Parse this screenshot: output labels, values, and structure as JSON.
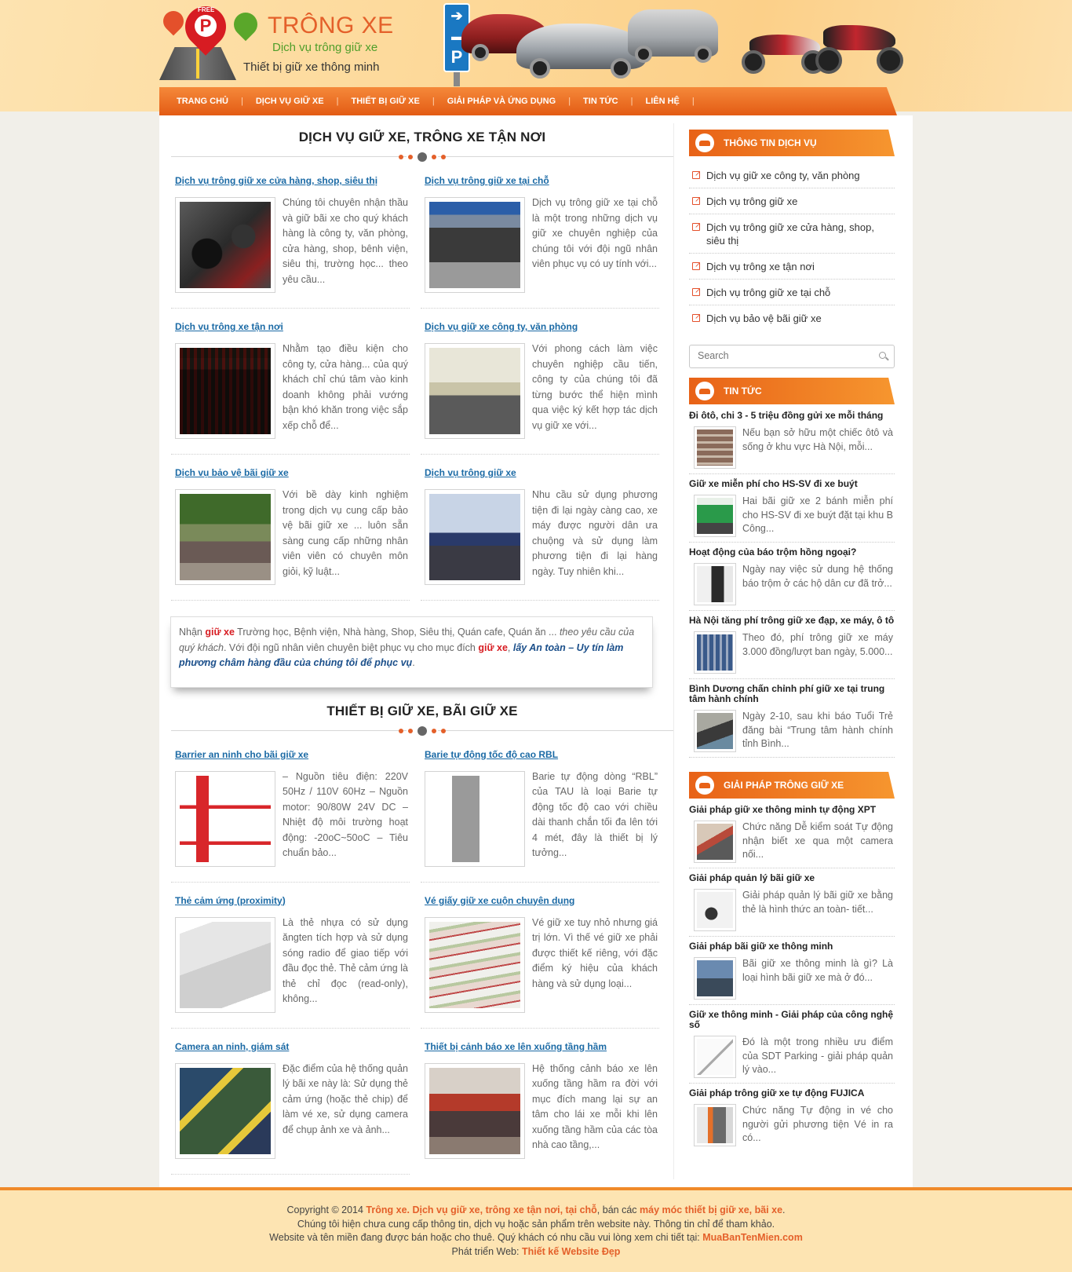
{
  "brand": {
    "title": "TRÔNG XE",
    "subtitle": "Dịch vụ trông giữ xe",
    "tagline": "Thiết bị giữ xe thông minh",
    "free_tag": "FREE",
    "p_letter": "P"
  },
  "nav": {
    "items": [
      {
        "label": "TRANG CHỦ"
      },
      {
        "label": "DỊCH VỤ GIỮ XE"
      },
      {
        "label": "THIẾT BỊ GIỮ XE"
      },
      {
        "label": "GIẢI PHÁP VÀ ỨNG DỤNG"
      },
      {
        "label": "TIN TỨC"
      },
      {
        "label": "LIÊN HỆ"
      }
    ]
  },
  "services_section": {
    "title": "DỊCH VỤ GIỮ XE, TRÔNG XE TẬN NƠI",
    "cards": [
      {
        "title": "Dịch vụ trông giữ xe cửa hàng, shop, siêu thị",
        "text": "Chúng tôi chuyên nhận thầu và giữ bãi xe cho quý khách hàng là công ty, văn phòng, cửa hàng, shop, bênh viện, siêu thị, trường học... theo yêu cầu..."
      },
      {
        "title": "Dịch vụ trông giữ xe tại chỗ",
        "text": "Dịch vụ trông giữ xe tại chỗ là một trong những dịch vụ giữ xe chuyên nghiệp của chúng tôi với đội ngũ nhân viên phục vụ có uy tính với..."
      },
      {
        "title": "Dịch vụ trông xe tận nơi",
        "text": "Nhằm tạo điều kiện cho công ty, cửa hàng... của quý khách chỉ chú tâm vào kinh doanh không phải vướng bận khó khăn trong việc sắp xếp chỗ để..."
      },
      {
        "title": "Dịch vụ giữ xe công ty, văn phòng",
        "text": "Với phong cách làm việc chuyên nghiệp cầu tiến, công ty của chúng tôi đã từng bước thể hiện mình qua việc ký kết hợp tác dịch vụ giữ xe với..."
      },
      {
        "title": "Dịch vụ bảo vệ bãi giữ xe",
        "text": "Với bề dày kinh nghiệm trong dịch vụ cung cấp bảo vệ bãi giữ xe ... luôn sẵn sàng cung cấp những nhân viên viên có chuyên môn giỏi, kỹ luật..."
      },
      {
        "title": "Dịch vụ trông giữ xe",
        "text": "Nhu cầu sử dụng phương tiện đi lại ngày càng cao, xe máy được người dân ưa chuộng và sử dụng làm phương tiện đi lại hàng ngày. Tuy nhiên khi..."
      }
    ]
  },
  "quote": {
    "p1": "Nhận ",
    "hl1": "giữ xe",
    "p2": " Trường học, Bệnh viện, Nhà hàng, Shop, Siêu thị, Quán cafe, Quán ăn ... ",
    "it1": "theo yêu cầu của quý khách",
    "p3": ". Với đội ngũ nhân viên chuyên biệt phục vụ cho mục đích ",
    "hl2": "giữ xe",
    "p4": ", ",
    "bi1": "lấy An toàn – Uy tín làm phương châm hàng đầu của chúng tôi để phục vụ",
    "p5": "."
  },
  "equipment_section": {
    "title": "THIẾT BỊ GIỮ XE, BÃI GIỮ XE",
    "cards": [
      {
        "title": "Barrier an ninh cho bãi giữ xe",
        "text": "– Nguồn tiêu điện: 220V 50Hz / 110V 60Hz – Nguồn motor: 90/80W 24V DC – Nhiệt độ môi trường hoạt động: -20oC~50oC – Tiêu chuẩn bảo..."
      },
      {
        "title": "Barie tự động tốc độ cao RBL",
        "text": "Barie tự động dòng “RBL” của TAU là loại Barie tự động tốc độ cao với chiều dài thanh chắn tối đa lên tới 4 mét, đây là thiết bị lý tưởng..."
      },
      {
        "title": "Thẻ cảm ứng (proximity)",
        "text": "Là thẻ nhựa có sử dụng ăngten tích hợp và sử dụng sóng radio để giao tiếp với đầu đọc thẻ. Thẻ cảm ứng là thẻ chỉ đọc (read-only), không..."
      },
      {
        "title": "Vé giấy giữ xe cuộn chuyên dụng",
        "text": "Vé giữ xe tuy nhỏ nhưng giá trị lớn. Vì thế vé giữ xe phải được thiết kế riêng, với đặc điểm ký hiệu của khách hàng và sử dụng loại..."
      },
      {
        "title": "Camera an ninh, giám sát",
        "text": "Đặc điểm của hệ thống quản lý bãi xe này là: Sử dụng thẻ cảm ứng (hoặc thẻ chip) để làm vé xe, sử dụng camera để chụp ảnh xe và ảnh..."
      },
      {
        "title": "Thiết bị cảnh báo xe lên xuống tầng hầm",
        "text": "Hệ thống cảnh báo xe lên xuống tầng hầm ra đời với mục đích mang lại sự an tâm cho lái xe mỗi khi lên xuống tầng hầm của các tòa nhà cao tầng,..."
      }
    ]
  },
  "sidebar": {
    "service_info": {
      "title": "THÔNG TIN DỊCH VỤ",
      "items": [
        "Dịch vụ giữ xe công ty, văn phòng",
        "Dịch vụ trông giữ xe",
        "Dịch vụ trông giữ xe cửa hàng, shop, siêu thị",
        "Dịch vụ trông xe tận nơi",
        "Dịch vụ trông giữ xe tại chỗ",
        "Dịch vụ bảo vệ bãi giữ xe"
      ]
    },
    "search": {
      "placeholder": "Search"
    },
    "news": {
      "title": "TIN TỨC",
      "items": [
        {
          "title": "Đi ôtô, chi 3 - 5 triệu đồng gửi xe mỗi tháng",
          "text": "Nếu bạn sở hữu một chiếc ôtô và sống ở khu vực Hà Nội, mỗi..."
        },
        {
          "title": "Giữ xe miễn phí cho HS-SV đi xe buýt",
          "text": "Hai bãi giữ xe 2 bánh miễn phí cho HS-SV đi xe buýt đặt tại khu B Công..."
        },
        {
          "title": "Hoạt động của báo trộm hồng ngoại?",
          "text": "Ngày nay việc sử dung hệ thống báo trộm ở các hộ dân cư đã trở..."
        },
        {
          "title": "Hà Nội tăng phí trông giữ xe đạp, xe máy, ô tô",
          "text": "Theo đó, phí trông giữ xe máy 3.000 đồng/lượt ban ngày, 5.000..."
        },
        {
          "title": "Bình Dương chấn chỉnh phí giữ xe tại trung tâm hành chính",
          "text": "Ngày 2-10, sau khi báo Tuổi Trẻ đăng bài “Trung tâm hành chính tỉnh Bình..."
        }
      ]
    },
    "solutions": {
      "title": "GIẢI PHÁP TRÔNG GIỮ XE",
      "items": [
        {
          "title": "Giải pháp giữ xe thông minh tự động XPT",
          "text": "Chức năng Dễ kiểm soát Tự động nhận biết xe qua một camera nối..."
        },
        {
          "title": "Giải pháp quản lý bãi giữ xe",
          "text": "Giải pháp quản lý bãi giữ xe bằng thẻ là hình thức an toàn- tiết..."
        },
        {
          "title": "Giải pháp bãi giữ xe thông minh",
          "text": "Bãi giữ xe thông minh là gì? Là loại hình bãi giữ xe mà ở đó..."
        },
        {
          "title": "Giữ xe thông minh - Giải pháp của công nghệ số",
          "text": "Đó là một trong nhiều ưu điểm của SDT Parking - giải pháp quản lý vào..."
        },
        {
          "title": "Giải pháp trông giữ xe tự động FUJICA",
          "text": "Chức năng Tự động in vé cho người gửi phương tiện Vé in ra có..."
        }
      ]
    }
  },
  "footer": {
    "l1a": "Copyright © 2014 ",
    "l1b": "Trông xe. Dịch vụ giữ xe, trông xe tận nơi, tại chỗ",
    "l1c": ", bán các ",
    "l1d": "máy móc thiết bị giữ xe, bãi xe",
    "l1e": ".",
    "l2": "Chúng tôi hiện chưa cung cấp thông tin, dịch vụ hoặc sản phẩm trên website này. Thông tin chỉ để tham khảo.",
    "l3a": "Website và tên miền đang được bán hoặc cho thuê. Quý khách có nhu cầu vui lòng xem chi tiết tại: ",
    "l3b": "MuaBanTenMien.com",
    "l4a": "Phát triển Web: ",
    "l4b": "Thiết kế Website Đẹp"
  }
}
